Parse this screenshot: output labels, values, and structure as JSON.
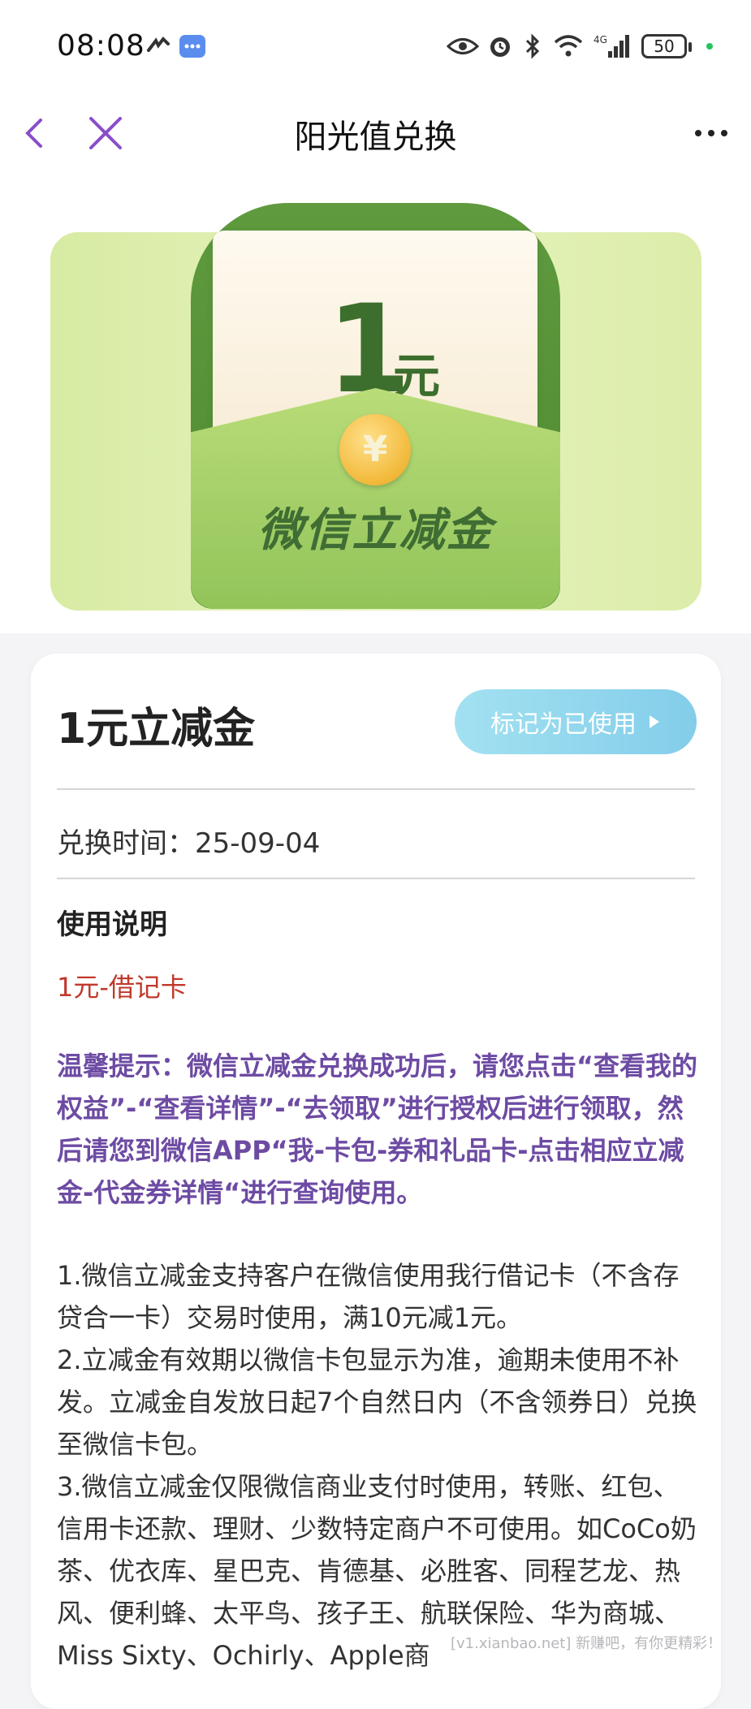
{
  "status_bar": {
    "time": "08:08",
    "battery": "50",
    "icons": [
      "app-icon",
      "message-icon",
      "eye-icon",
      "alarm-icon",
      "bluetooth-icon",
      "wifi-icon",
      "signal-4g-icon",
      "battery-icon"
    ]
  },
  "nav": {
    "title": "阳光值兑换",
    "back_icon": "back-icon",
    "close_icon": "close-icon",
    "more_icon": "more-icon"
  },
  "hero": {
    "amount": "1",
    "unit": "元",
    "coin_symbol": "¥",
    "label": "微信立减金"
  },
  "card": {
    "title": "1元立减金",
    "mark_button": "标记为已使用",
    "exchange_time": "兑换时间：25-09-04",
    "usage_title": "使用说明",
    "usage_red": "1元-借记卡",
    "tip": "温馨提示：微信立减金兑换成功后，请您点击“查看我的权益”-“查看详情”-“去领取”进行授权后进行领取，然后请您到微信APP“我-卡包-券和礼品卡-点击相应立减金-代金券详情“进行查询使用。",
    "rules": [
      "1.微信立减金支持客户在微信使用我行借记卡（不含存贷合一卡）交易时使用，满10元减1元。",
      "2.立减金有效期以微信卡包显示为准，逾期未使用不补发。立减金自发放日起7个自然日内（不含领券日）兑换至微信卡包。",
      "3.微信立减金仅限微信商业支付时使用，转账、红包、信用卡还款、理财、少数特定商户不可使用。如CoCo奶茶、优衣库、星巴克、肯德基、必胜客、同程艺龙、热风、便利蜂、太平鸟、孩子王、航联保险、华为商城、Miss Sixty、Ochirly、Apple商"
    ]
  },
  "watermark": "[v1.xianbao.net] 新赚吧，有你更精彩！",
  "colors": {
    "accent_purple": "#8a4dc9",
    "tip_purple": "#6d4ba3",
    "red": "#c0392b",
    "button_blue": "#8fd3ec",
    "green_dark": "#3c6f2d"
  }
}
